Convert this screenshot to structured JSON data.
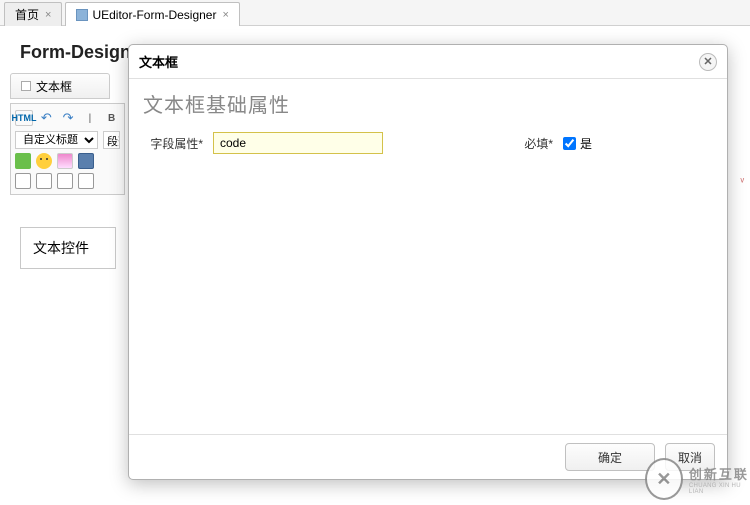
{
  "tabs": {
    "home": "首页",
    "editor": "UEditor-Form-Designer"
  },
  "page_title": "Form-Designer",
  "component_bar": {
    "textbox": "文本框"
  },
  "editor_toolbar": {
    "html_label": "HTML",
    "title_select": "自定义标题",
    "para_select": "段落"
  },
  "widget_box": {
    "label": "文本控件"
  },
  "dialog": {
    "title": "文本框",
    "section_title": "文本框基础属性",
    "field_attr_label": "字段属性*",
    "field_attr_value": "code",
    "required_label": "必填*",
    "required_value_label": "是",
    "required_checked": true,
    "ok": "确定",
    "cancel": "取消"
  },
  "watermark": {
    "cn": "创新互联",
    "en": "CHUANG XIN HU LIAN"
  }
}
